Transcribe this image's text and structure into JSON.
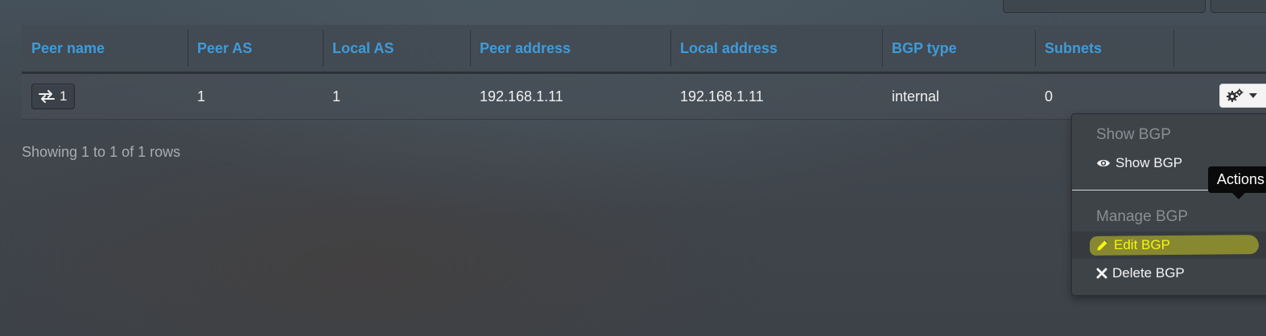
{
  "table": {
    "columns": [
      "Peer name",
      "Peer AS",
      "Local AS",
      "Peer address",
      "Local address",
      "BGP type",
      "Subnets",
      ""
    ],
    "rows": [
      {
        "peer_name": "1",
        "peer_as": "1",
        "local_as": "1",
        "peer_address": "192.168.1.11",
        "local_address": "192.168.1.11",
        "bgp_type": "internal",
        "subnets": "0"
      }
    ],
    "footer": "Showing 1 to 1 of 1 rows"
  },
  "actions_menu": {
    "show_header": "Show BGP",
    "show_item": "Show BGP",
    "manage_header": "Manage BGP",
    "edit_item": "Edit BGP",
    "delete_item": "Delete BGP"
  },
  "tooltip": "Actions",
  "icons": {
    "peer_button": "exchange-icon",
    "actions_button": "gears-icon",
    "show": "eye-icon",
    "edit": "pencil-icon",
    "delete": "close-icon"
  },
  "colors": {
    "header_text": "#3f9bd8",
    "highlight": "#f5f514"
  }
}
